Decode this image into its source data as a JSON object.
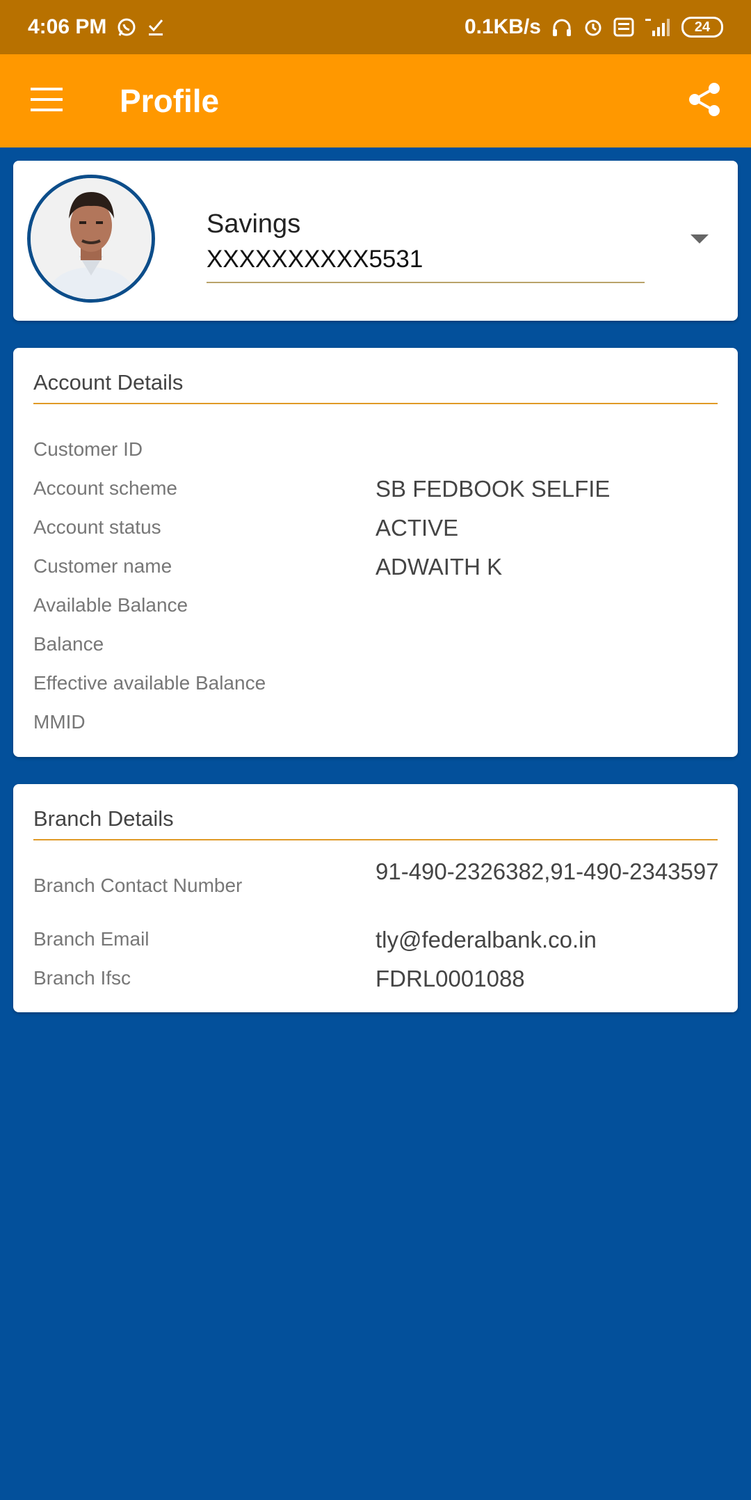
{
  "status_bar": {
    "time": "4:06 PM",
    "net_speed": "0.1KB/s",
    "network": "4G",
    "volte": "Vo LTE",
    "battery": "24"
  },
  "app_bar": {
    "title": "Profile",
    "menu_icon": "hamburger-menu-icon",
    "share_icon": "share-icon"
  },
  "account": {
    "type": "Savings",
    "number": "XXXXXXXXXX5531"
  },
  "account_details": {
    "title": "Account Details",
    "rows": [
      {
        "label": "Customer ID",
        "value": ""
      },
      {
        "label": "Account scheme",
        "value": "SB FEDBOOK SELFIE"
      },
      {
        "label": "Account status",
        "value": "ACTIVE"
      },
      {
        "label": "Customer name",
        "value": "ADWAITH K"
      },
      {
        "label": "Available Balance",
        "value": ""
      },
      {
        "label": "Balance",
        "value": ""
      },
      {
        "label": "Effective available Balance",
        "value": ""
      },
      {
        "label": "MMID",
        "value": ""
      }
    ]
  },
  "branch_details": {
    "title": "Branch Details",
    "rows": [
      {
        "label": "Branch Contact Number",
        "value": "91-490-2326382,91-490-2343597"
      },
      {
        "label": "Branch Email",
        "value": "tly@federalbank.co.in"
      },
      {
        "label": "Branch Ifsc",
        "value": "FDRL0001088"
      }
    ]
  },
  "colors": {
    "status_bar": "#b87100",
    "app_bar": "#ff9800",
    "background": "#03509b",
    "accent_rule": "#e09a26"
  }
}
